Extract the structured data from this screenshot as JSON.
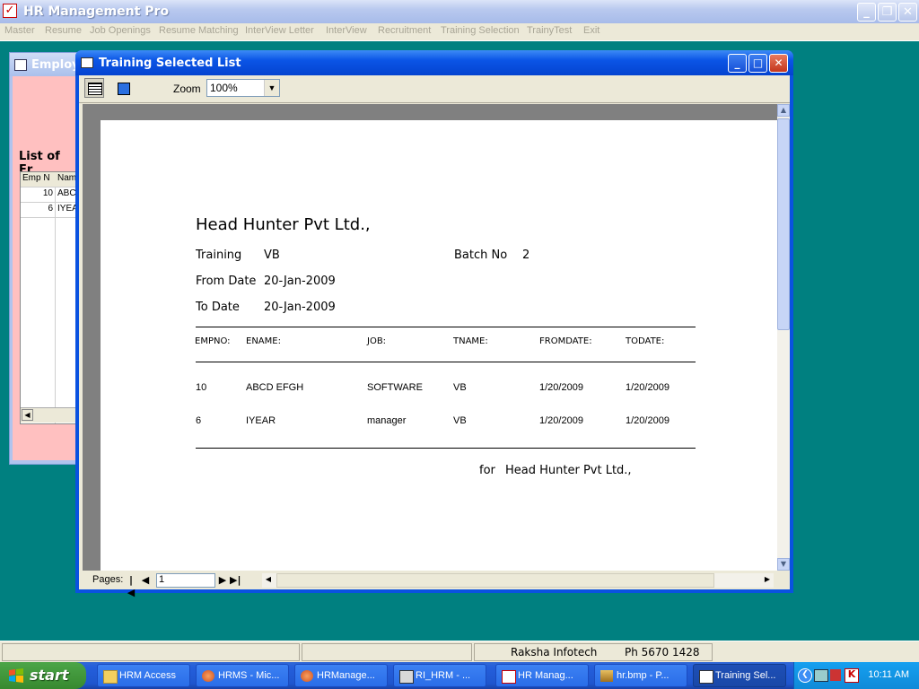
{
  "app": {
    "title": "HR Management Pro",
    "caption_buttons": {
      "minimize": "_",
      "restore": "❐",
      "close": "✕"
    }
  },
  "menu": [
    "Master",
    "Resume",
    "Job Openings",
    "Resume Matching",
    "InterView Letter",
    "InterView",
    "Recruitment",
    "Training Selection",
    "TrainyTest",
    "Exit"
  ],
  "employee_window": {
    "title": "Employe",
    "list_label": "List of Er",
    "grid_headers": [
      "Emp N",
      "Nam"
    ],
    "rows": [
      [
        "10",
        "ABC"
      ],
      [
        "6",
        "IYEA"
      ]
    ]
  },
  "training_window": {
    "title": "Training Selected List",
    "zoom_label": "Zoom",
    "zoom_value": "100%",
    "pages_label": "Pages:",
    "page_value": "1"
  },
  "report": {
    "company": "Head Hunter Pvt Ltd.,",
    "training_label": "Training",
    "training_value": "VB",
    "batch_label": "Batch No",
    "batch_value": "2",
    "from_label": "From Date",
    "from_value": "20-Jan-2009",
    "to_label": "To Date",
    "to_value": "20-Jan-2009",
    "columns": [
      "EMPNO:",
      "ENAME:",
      "JOB:",
      "TNAME:",
      "FROMDATE:",
      "TODATE:"
    ],
    "rows": [
      [
        "10",
        "ABCD EFGH",
        "SOFTWARE",
        "VB",
        "1/20/2009",
        "1/20/2009"
      ],
      [
        "6",
        "IYEAR",
        "manager",
        "VB",
        "1/20/2009",
        "1/20/2009"
      ]
    ],
    "footer_for": "for",
    "footer_company": "Head Hunter Pvt Ltd.,"
  },
  "statusbar": {
    "company": "Raksha Infotech",
    "phone": "Ph 5670 1428"
  },
  "taskbar": {
    "start": "start",
    "buttons": [
      {
        "label": "HRM Access",
        "icon": "folder-icon"
      },
      {
        "label": "HRMS - Mic...",
        "icon": "vb-icon"
      },
      {
        "label": "HRManage...",
        "icon": "vb-icon"
      },
      {
        "label": "RI_HRM - ...",
        "icon": "app-icon"
      },
      {
        "label": "HR Manag...",
        "icon": "hr-icon"
      },
      {
        "label": "hr.bmp - P...",
        "icon": "paint-icon"
      },
      {
        "label": "Training Sel...",
        "icon": "report-icon"
      }
    ],
    "clock": "10:11 AM"
  },
  "colors": {
    "desktop": "#008080",
    "title_active": "#0a52e0",
    "employee_bg": "#ffc0c0"
  }
}
